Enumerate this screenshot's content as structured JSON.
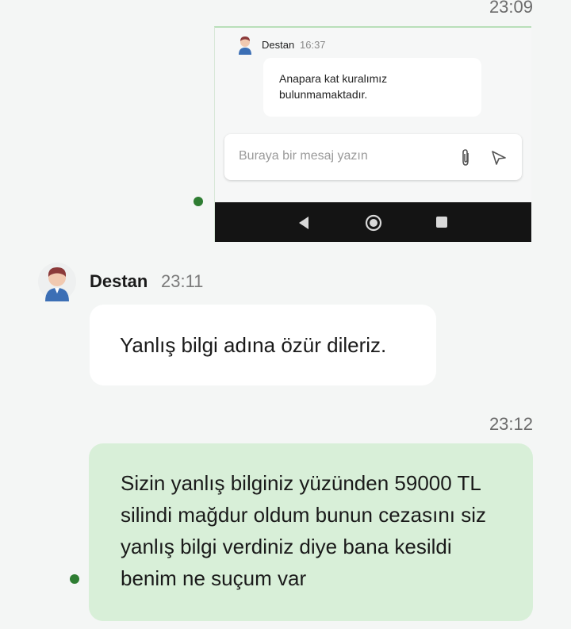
{
  "top_message": {
    "time": "23:09",
    "screenshot": {
      "sender_name": "Destan",
      "sender_time": "16:37",
      "message_text": "Anapara kat kuralımız bulunmamaktadır.",
      "input_placeholder": "Buraya bir mesaj yazın",
      "icons": [
        "paperclip-icon",
        "send-icon",
        "back-icon",
        "home-icon",
        "recents-icon"
      ]
    },
    "status_color": "#2e7d32"
  },
  "agent_message": {
    "sender_name": "Destan",
    "time": "23:11",
    "text": "Yanlış bilgi adına özür dileriz."
  },
  "user_message": {
    "time": "23:12",
    "text": "Sizin yanlış bilginiz yüzünden 59000 TL silindi mağdur oldum bunun cezasını siz yanlış bilgi verdiniz diye bana kesildi benim ne suçum var",
    "bubble_color": "#d8efd8",
    "status_color": "#2e7d32"
  }
}
